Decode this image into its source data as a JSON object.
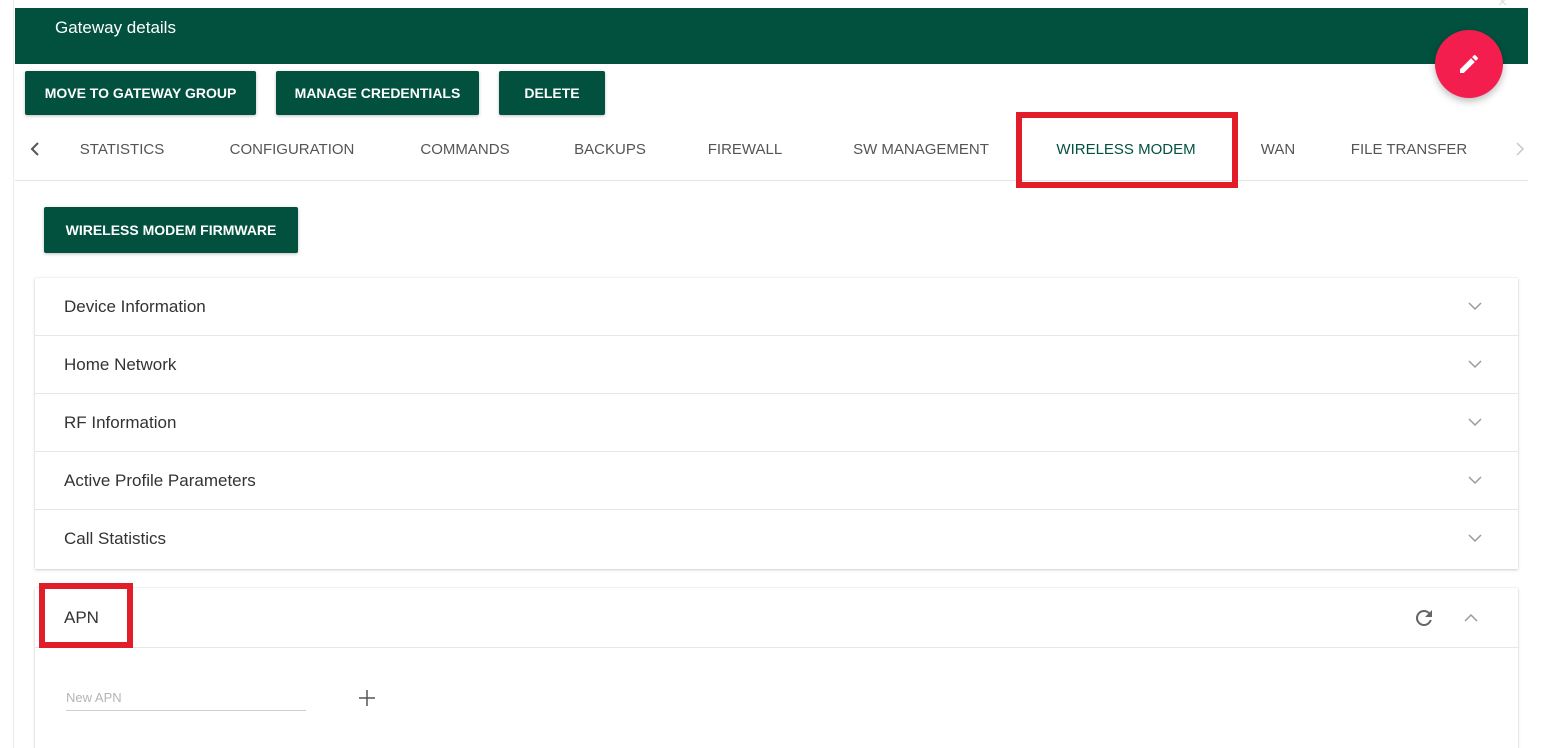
{
  "header": {
    "title": "Gateway details"
  },
  "actions": {
    "move_to_group": "MOVE TO GATEWAY GROUP",
    "manage_credentials": "MANAGE CREDENTIALS",
    "delete": "DELETE"
  },
  "tabs": [
    {
      "label": "STATISTICS",
      "active": false
    },
    {
      "label": "CONFIGURATION",
      "active": false
    },
    {
      "label": "COMMANDS",
      "active": false
    },
    {
      "label": "BACKUPS",
      "active": false
    },
    {
      "label": "FIREWALL",
      "active": false
    },
    {
      "label": "SW MANAGEMENT",
      "active": false
    },
    {
      "label": "WIRELESS MODEM",
      "active": true
    },
    {
      "label": "WAN",
      "active": false
    },
    {
      "label": "FILE TRANSFER",
      "active": false
    }
  ],
  "firmware_button": "WIRELESS MODEM FIRMWARE",
  "panels": [
    {
      "label": "Device Information",
      "expanded": false
    },
    {
      "label": "Home Network",
      "expanded": false
    },
    {
      "label": "RF Information",
      "expanded": false
    },
    {
      "label": "Active Profile Parameters",
      "expanded": false
    },
    {
      "label": "Call Statistics",
      "expanded": false
    }
  ],
  "apn": {
    "title": "APN",
    "expanded": true,
    "input_placeholder": "New APN",
    "input_value": ""
  },
  "icons": {
    "fab": "pencil-icon",
    "tab_prev": "chevron-left-icon",
    "tab_next": "chevron-right-icon",
    "panel_toggle": "chevron-down-icon",
    "apn_refresh": "refresh-icon",
    "apn_toggle": "chevron-up-icon",
    "apn_add": "plus-icon"
  },
  "colors": {
    "brand_green": "#02513f",
    "fab_red": "#f31d4e",
    "highlight_red": "#e21d2a"
  }
}
